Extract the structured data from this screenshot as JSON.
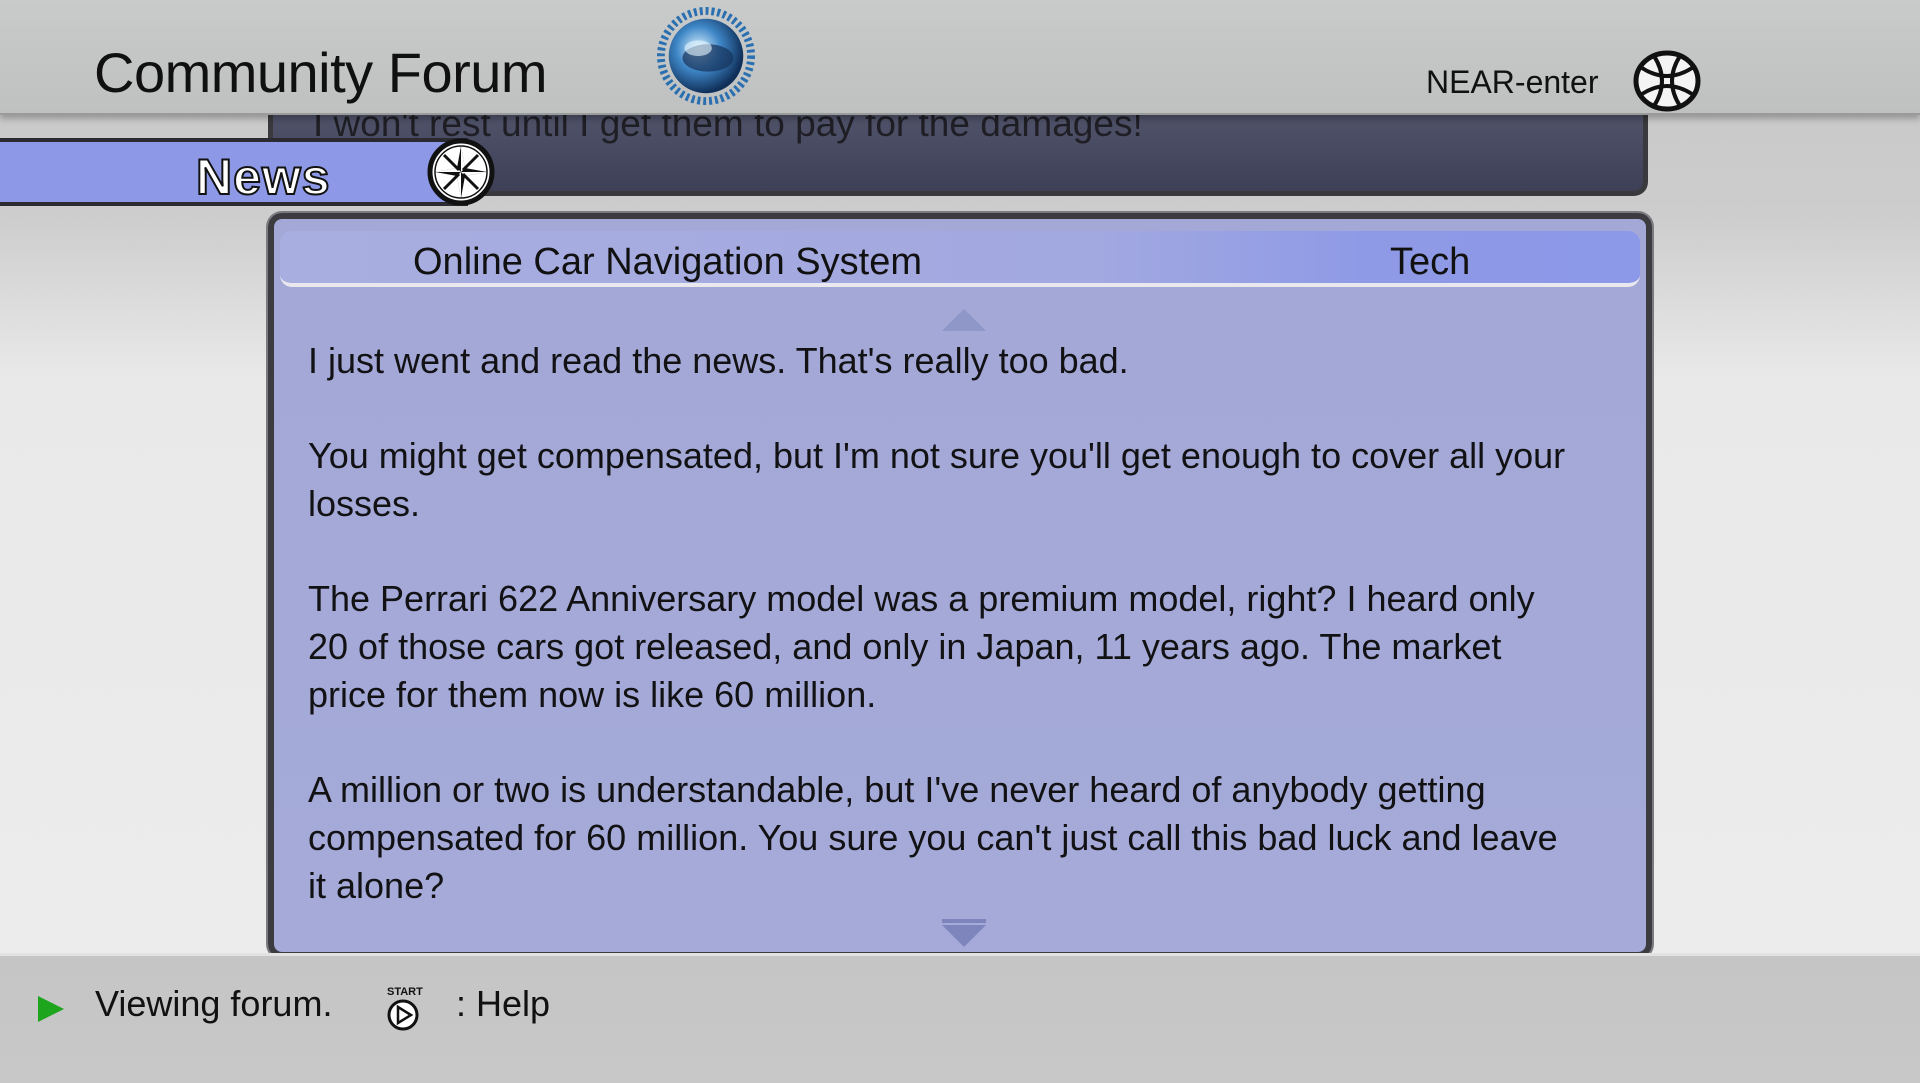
{
  "header": {
    "title": "Community Forum",
    "logo_icon": "spinning-globe-icon",
    "near_enter_label": "NEAR-enter",
    "web_icon": "globe-wireframe-icon"
  },
  "previous_post": {
    "text": "I won't rest until I get them to pay for the damages!"
  },
  "news_tab": {
    "label": "News",
    "icon": "compass-icon",
    "color": "#8d98e6"
  },
  "post": {
    "title": "Online Car Navigation System",
    "category": "Tech",
    "paragraphs": [
      "I just went and read the news. That's really too bad.",
      "You might get compensated, but I'm not sure you'll get enough to cover all your losses.",
      "The Perrari 622 Anniversary model was a premium model, right? I heard only 20 of those cars got released, and only in Japan, 11 years ago. The market price for them now is like 60 million.",
      "A million or two is understandable, but I've never heard of anybody getting compensated for 60 million. You sure you can't just call this bad luck and leave it alone?"
    ],
    "background_color": "#a3a8d6"
  },
  "status_bar": {
    "text": "Viewing forum.",
    "help_label": ": Help",
    "start_label": "START",
    "play_color": "#1ea51e"
  }
}
